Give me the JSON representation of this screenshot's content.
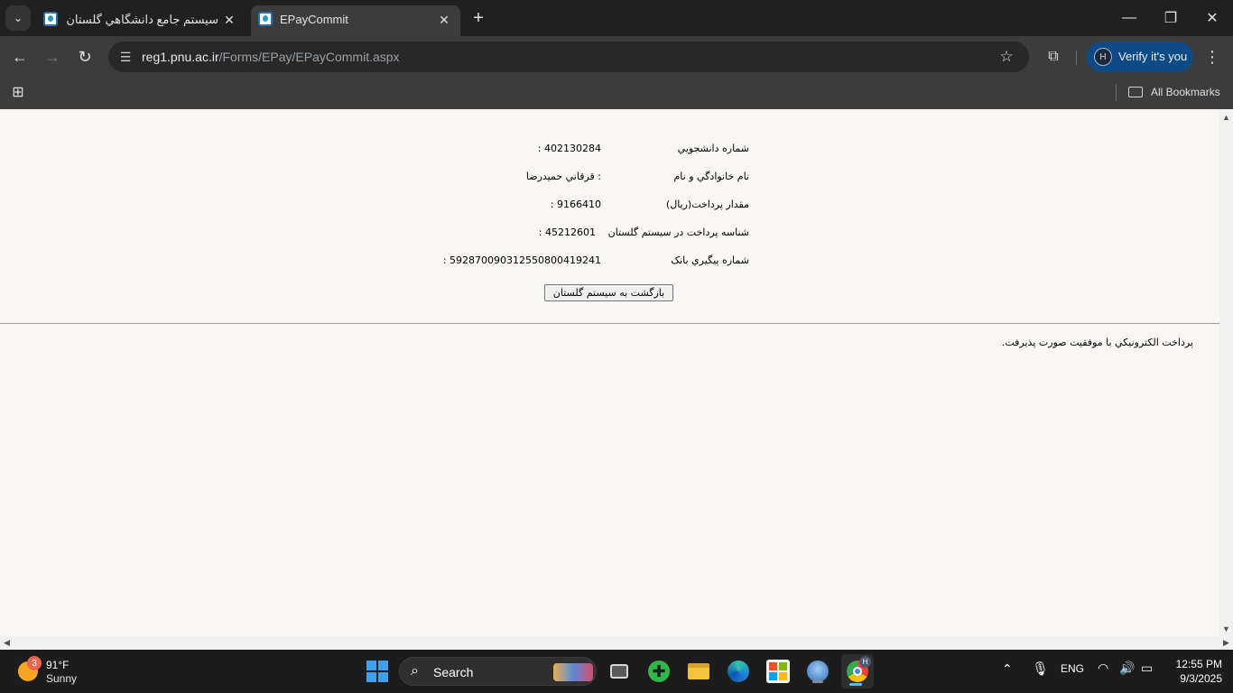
{
  "browser": {
    "tabs": [
      {
        "title": "سيستم جامع دانشگاهي گلستان -",
        "active": false
      },
      {
        "title": "EPayCommit",
        "active": true
      }
    ],
    "url_host": "reg1.pnu.ac.ir",
    "url_path": "/Forms/EPay/EPayCommit.aspx",
    "verify_label": "Verify it's you",
    "profile_initial": "H",
    "bookmarks_label": "All Bookmarks"
  },
  "page": {
    "rows": [
      {
        "label": "شماره دانشجويي",
        "value": "402130284 :"
      },
      {
        "label": "نام خانوادگي و نام",
        "value": ": قرقاني حميدرضا"
      },
      {
        "label": "مقدار پرداخت(ريال)",
        "value": "9166410 :"
      },
      {
        "label": "شناسه پرداخت در سيستم گلستان",
        "value": "45212601 :"
      },
      {
        "label": "شماره پيگيري بانک",
        "value": "592870090312550800419241 :"
      }
    ],
    "back_button": "بازگشت به سيستم گلستان",
    "success_message": "پرداخت الکترونيکي با موفقيت صورت پذيرفت."
  },
  "taskbar": {
    "weather_temp": "91°F",
    "weather_condition": "Sunny",
    "weather_badge": "3",
    "search_placeholder": "Search",
    "language": "ENG",
    "time": "12:55 PM",
    "date": "9/3/2025",
    "chrome_badge": "H"
  }
}
